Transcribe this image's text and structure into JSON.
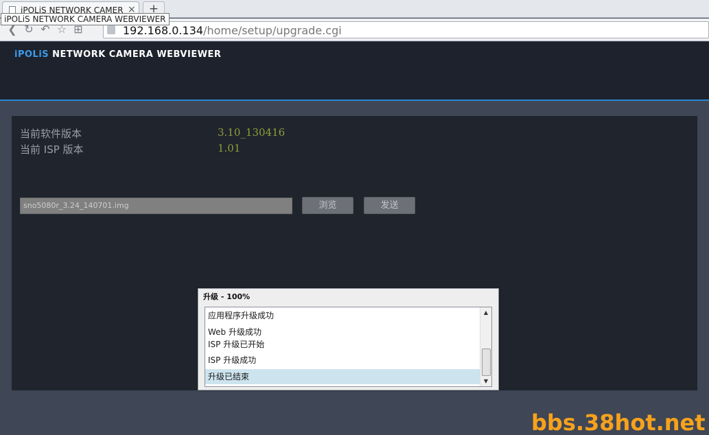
{
  "browser": {
    "tab_title": "iPOLiS NETWORK CAMER",
    "tab_close": "×",
    "new_tab": "+",
    "tooltip": "iPOLiS NETWORK CAMERA WEBVIEWER",
    "url_host": "192.168.0.134",
    "url_path": "/home/setup/upgrade.cgi",
    "nav_icons": [
      "back-icon",
      "reload-icon",
      "undo-icon",
      "bookmark-star-icon",
      "home-icon"
    ]
  },
  "header": {
    "brand_prefix": "iPOLiS",
    "brand_rest": "NETWORK CAMERA WEBVIEWER",
    "accent_color": "#2e87d3"
  },
  "info": {
    "software_label": "当前软件版本",
    "software_value": "3.10_130416",
    "isp_label": "当前 ISP 版本",
    "isp_value": "1.01"
  },
  "upload": {
    "file_value": "sno5080r_3.24_140701.img",
    "browse_label": "浏览",
    "send_label": "发送"
  },
  "dialog": {
    "title": "升级 - 100%",
    "progress_percent": 100,
    "log_lines": [
      "应用程序升级成功",
      "Web 升级成功",
      "ISP 升级已开始",
      "ISP 升级成功",
      "升级已结束"
    ],
    "selected_index": 4
  },
  "watermark": "bbs.38hot.net"
}
